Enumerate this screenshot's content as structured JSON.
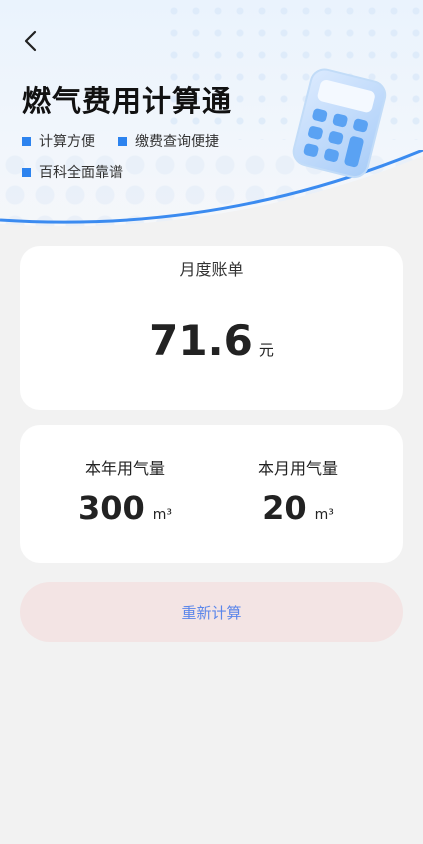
{
  "header": {
    "back_icon": "chevron-left-icon",
    "title": "燃气费用计算通",
    "features": [
      "计算方便",
      "缴费查询便捷",
      "百科全面靠谱"
    ],
    "accent_color": "#2c83ef",
    "illustration": "calculator-icon"
  },
  "bill": {
    "label": "月度账单",
    "amount": "71.6",
    "unit": "元"
  },
  "usage": {
    "year": {
      "label": "本年用气量",
      "value": "300",
      "unit": "m³"
    },
    "month": {
      "label": "本月用气量",
      "value": "20",
      "unit": "m³"
    }
  },
  "actions": {
    "recalc_label": "重新计算"
  }
}
